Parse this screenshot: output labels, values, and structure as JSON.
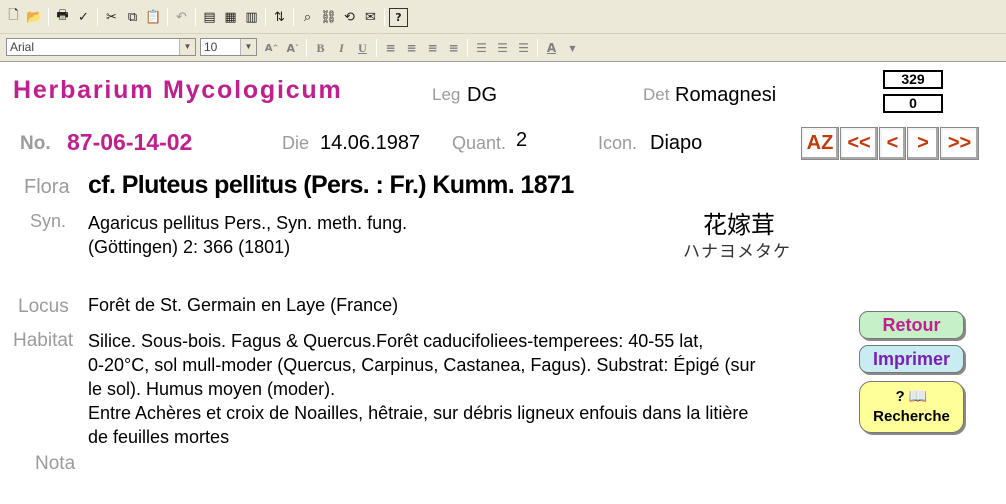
{
  "toolbar": {
    "row1_icons": [
      "new-document-icon",
      "open-folder-icon",
      "sep",
      "print-icon",
      "spellcheck-icon",
      "sep",
      "cut-icon",
      "copy-icon",
      "paste-icon",
      "sep",
      "undo-icon",
      "sep",
      "list-view-icon",
      "form-view-icon",
      "table-view-icon",
      "sep",
      "sort-icon",
      "sep",
      "query-icon",
      "link-icon",
      "relink-icon",
      "mail-icon",
      "sep",
      "help-icon"
    ],
    "font_name": "Arial",
    "font_size": "10"
  },
  "header": {
    "title": "Herbarium Mycologicum",
    "leg_label": "Leg",
    "leg_value": "DG",
    "det_label": "Det",
    "det_value": "Romagnesi",
    "counter_total": "329",
    "counter_current": "0"
  },
  "record": {
    "no_label": "No.",
    "no_value": "87-06-14-02",
    "die_label": "Die",
    "die_value": "14.06.1987",
    "quant_label": "Quant.",
    "quant_value": "2",
    "icon_label": "Icon.",
    "icon_value": "Diapo"
  },
  "nav": {
    "az": "AZ",
    "first": "<<",
    "prev": "<",
    "next": ">",
    "last": ">>"
  },
  "flora": {
    "label": "Flora",
    "value": "cf.  Pluteus pellitus (Pers. : Fr.) Kumm. 1871"
  },
  "syn": {
    "label": "Syn.",
    "line1": "Agaricus pellitus Pers., Syn. meth. fung.",
    "line2": "(Göttingen) 2: 366 (1801)"
  },
  "japanese": {
    "kanji": "花嫁茸",
    "kana": "ハナヨメタケ"
  },
  "locus": {
    "label": "Locus",
    "value": "Forêt de St. Germain en Laye (France)"
  },
  "habitat": {
    "label": "Habitat",
    "line1": "Silice. Sous-bois. Fagus & Quercus.Forêt caducifoliees-temperees: 40-55 lat,",
    "line2": "0-20°C, sol mull-moder (Quercus, Carpinus, Castanea, Fagus). Substrat: Épigé (sur",
    "line3": "le sol). Humus moyen (moder).",
    "line4": "Entre Achères et croix de Noailles, hêtraie, sur débris ligneux enfouis dans la litière",
    "line5": "de feuilles mortes"
  },
  "nota": {
    "label": "Nota"
  },
  "actions": {
    "retour": "Retour",
    "imprimer": "Imprimer",
    "recherche_icon": "? 📖",
    "recherche": "Recherche"
  },
  "colors": {
    "title": "#c0208f",
    "nav_text": "#c33a0c",
    "retour_bg": "#c6f1c6",
    "imprimer_bg": "#c8ecf2",
    "recherche_bg": "#ffff99"
  }
}
